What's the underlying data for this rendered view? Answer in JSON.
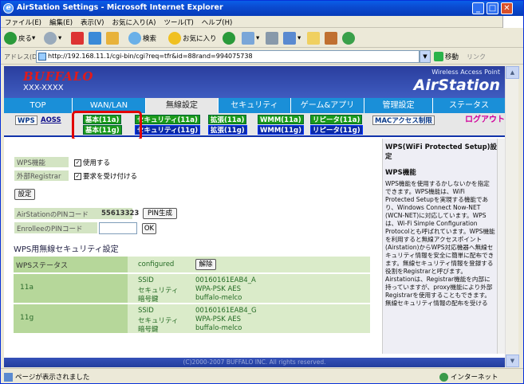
{
  "window": {
    "title": "AirStation Settings - Microsoft Internet Explorer"
  },
  "menu": [
    "ファイル(E)",
    "編集(E)",
    "表示(V)",
    "お気に入り(A)",
    "ツール(T)",
    "ヘルプ(H)"
  ],
  "toolbar": {
    "back": "戻る",
    "search": "検索",
    "favorites": "お気に入り"
  },
  "address": {
    "label": "アドレス(D)",
    "url": "http://192.168.11.1/cgi-bin/cgi?req=tfr&id=88rand=994075738",
    "go": "移動",
    "links": "リンク"
  },
  "banner": {
    "brand": "BUFFALO",
    "model": "XXX-XXXX",
    "tagline": "Wireless Access Point",
    "product": "AirStation"
  },
  "tabs": [
    "TOP",
    "WAN/LAN",
    "無線設定",
    "セキュリティ",
    "ゲーム&アプリ",
    "管理設定",
    "ステータス"
  ],
  "subnav": {
    "wps": "WPS",
    "aoss": "AOSS",
    "b11a": "基本(11a)",
    "b11g": "基本(11g)",
    "s11a": "セキュリティ(11a)",
    "s11g": "セキュリティ(11g)",
    "e11a": "拡張(11a)",
    "e11g": "拡張(11g)",
    "w11a": "WMM(11a)",
    "w11g": "WMM(11g)",
    "r11a": "リピータ(11a)",
    "r11g": "リピータ(11g)",
    "mac": "MACアクセス制限",
    "logout": "ログアウト"
  },
  "form": {
    "wps_label": "WPS機能",
    "wps_check": "使用する",
    "ext_label": "外部Registrar",
    "ext_check": "要求を受け付ける",
    "set_button": "設定",
    "pin_label": "AirStationのPINコード",
    "pin_value": "55613323",
    "pin_button": "PIN生成",
    "enrollee_label": "EnrolleeのPINコード",
    "ok_button": "OK"
  },
  "security": {
    "heading": "WPS用無線セキュリティ設定",
    "status_label": "WPSステータス",
    "status_value": "configured",
    "release_button": "解除",
    "rows": [
      {
        "band": "11a",
        "ssid_k": "SSID",
        "ssid_v": "00160161EAB4_A",
        "sec_k": "セキュリティ",
        "sec_v": "WPA-PSK AES",
        "key_k": "暗号鍵",
        "key_v": "buffalo-melco"
      },
      {
        "band": "11g",
        "ssid_k": "SSID",
        "ssid_v": "00160161EAB4_G",
        "sec_k": "セキュリティ",
        "sec_v": "WPA-PSK AES",
        "key_k": "暗号鍵",
        "key_v": "buffalo-melco"
      }
    ]
  },
  "footer": "(C)2000-2007 BUFFALO INC. All rights reserved.",
  "help": {
    "title": "WPS(WiFi Protected Setup)設定",
    "sub": "WPS機能",
    "body": "WPS機能を使用するかしないかを指定できます。WPS機能は、WiFi Protected Setupを実現する機能であり、Windows Connect Now-NET (WCN-NET)に対応しています。WPSは、Wi-Fi Simple Configuration Protocolとも呼ばれています。WPS機能を利用すると無線アクセスポイント(Airstation)からWPS対応機器へ無線セキュリティ情報を安全に簡単に配布できます。無線セキュリティ情報を登録する役割をRegistrarと呼びます。Airstationは、Registrar機能を内部に持っていますが、proxy機能により外部Registrarを使用することもできます。無線セキュリティ情報の配布を受ける"
  },
  "status": {
    "left": "ページが表示されました",
    "zone": "インターネット"
  }
}
